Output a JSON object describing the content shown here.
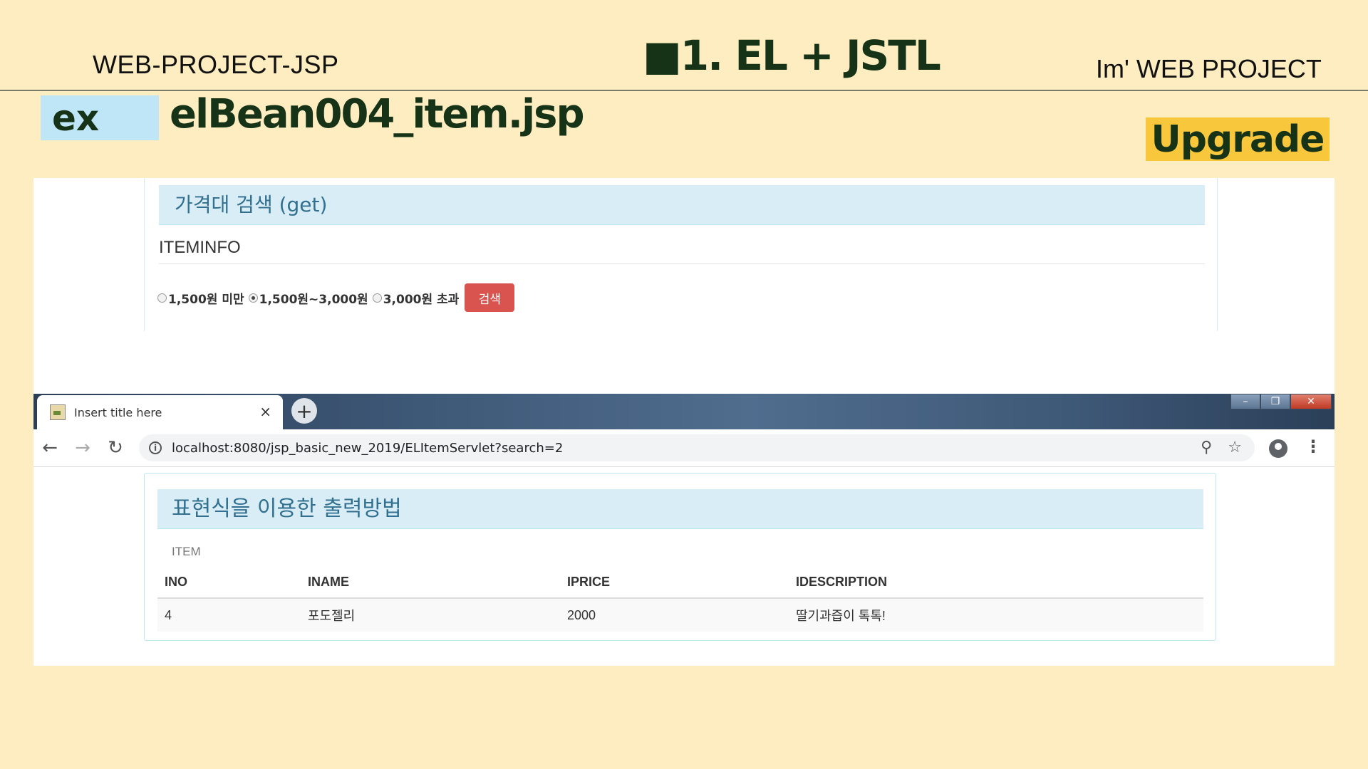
{
  "slide": {
    "header_left": "WEB-PROJECT-JSP",
    "title": "■1. EL + JSTL",
    "header_right": "Im'  WEB PROJECT",
    "ex_label": "ex",
    "file_name": "elBean004_item.jsp",
    "badge": "Upgrade"
  },
  "form": {
    "heading": "가격대 검색 (get)",
    "subtitle": "ITEMINFO",
    "options": [
      {
        "label": "1,500원 미만",
        "checked": false
      },
      {
        "label": "1,500원~3,000원",
        "checked": true
      },
      {
        "label": "3,000원 초과",
        "checked": false
      }
    ],
    "search_button": "검색"
  },
  "browser": {
    "tab_title": "Insert title here",
    "tab_close": "×",
    "new_tab": "+",
    "url": "localhost:8080/jsp_basic_new_2019/ELItemServlet?search=2",
    "icons": [
      "back-icon",
      "forward-icon",
      "reload-icon",
      "info-icon",
      "zoom-icon",
      "star-icon",
      "account-icon",
      "menu-icon"
    ]
  },
  "result": {
    "heading": "표현식을 이용한 출력방법",
    "caption": "ITEM",
    "columns": [
      "INO",
      "INAME",
      "IPRICE",
      "IDESCRIPTION"
    ],
    "rows": [
      [
        "4",
        "포도젤리",
        "2000",
        "딸기과즙이 톡톡!"
      ]
    ]
  },
  "colors": {
    "background": "#fdedc0",
    "title_green": "#163318",
    "ex_badge": "#bfe6f6",
    "upgrade_badge": "#f9c73c",
    "panel_heading": "#d9edf7",
    "danger_button": "#d9534f"
  }
}
